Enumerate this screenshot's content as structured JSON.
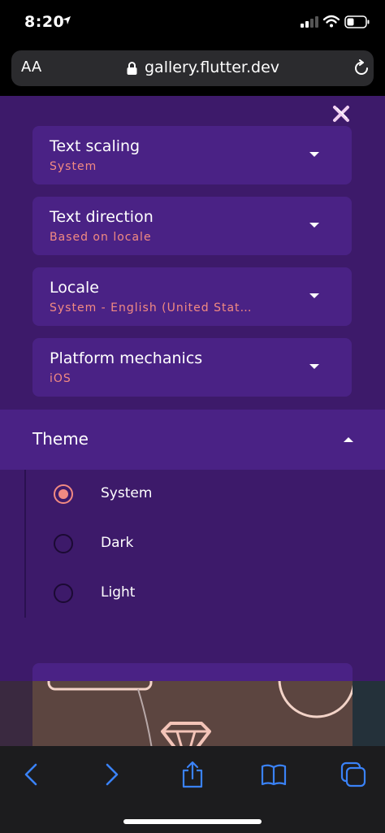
{
  "status_bar": {
    "time": "8:20",
    "icons": [
      "location-arrow-icon",
      "cellular-signal-icon",
      "wifi-icon",
      "battery-icon"
    ]
  },
  "browser": {
    "text_size_label": "AA",
    "url": "gallery.flutter.dev",
    "icons": [
      "lock-icon",
      "reload-icon"
    ]
  },
  "settings": {
    "close_icon": "close-icon",
    "items": [
      {
        "title": "Text scaling",
        "value": "System"
      },
      {
        "title": "Text direction",
        "value": "Based on locale"
      },
      {
        "title": "Locale",
        "value": "System - English (United Stat…"
      },
      {
        "title": "Platform mechanics",
        "value": "iOS"
      }
    ],
    "theme": {
      "title": "Theme",
      "selected": "System",
      "options": [
        {
          "label": "System",
          "checked": true
        },
        {
          "label": "Dark",
          "checked": false
        },
        {
          "label": "Light",
          "checked": false
        }
      ]
    }
  },
  "toolbar": {
    "icons": [
      "back-icon",
      "forward-icon",
      "share-icon",
      "bookmarks-icon",
      "tabs-icon"
    ]
  },
  "colors": {
    "panel_background": "#3d1a6a",
    "card_background": "#4a2285",
    "accent": "#f28a82",
    "toolbar_icon": "#3a82f7"
  }
}
